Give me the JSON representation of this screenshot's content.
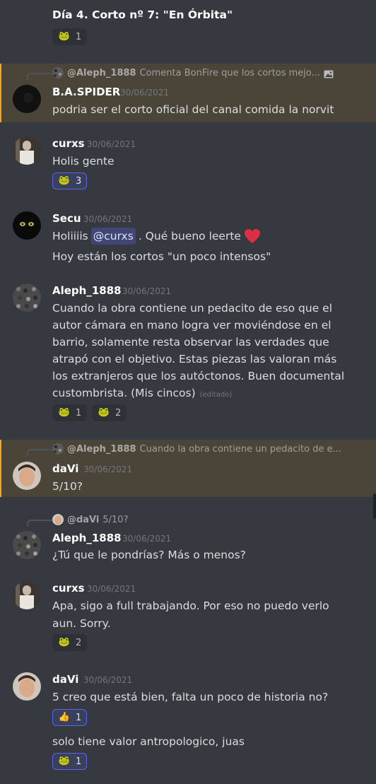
{
  "colors": {
    "background": "#36393f",
    "highlight": "#4a4538",
    "accent": "#faa61a",
    "active_reaction": "#5865f2"
  },
  "top": {
    "title": "Día 4. Corto nº 7: \"En Órbita\"",
    "reaction": {
      "emoji_icon": "pepe-cowboy-icon",
      "emoji": "🐸",
      "count": "1"
    }
  },
  "messages": [
    {
      "reply_user": "@Aleph_1888",
      "reply_text": "Comenta BonFire que los cortos mejo...",
      "reply_attachment_icon": "image-icon",
      "username": "B.A.SPIDER",
      "timestamp": "30/06/2021",
      "lines": [
        "podria ser el corto oficial del canal comida la norvit"
      ]
    },
    {
      "username": "curxs",
      "timestamp": "30/06/2021",
      "lines": [
        "Holis gente"
      ],
      "reactions": [
        {
          "emoji_icon": "pepe-hype-icon",
          "emoji": "🐸",
          "count": "3"
        }
      ]
    },
    {
      "username": "Secu",
      "timestamp": "30/06/2021",
      "line1_before": "Holiiiis",
      "mention": "@curxs",
      "line1_after": ". Qué bueno leerte",
      "heart_icon": "red-heart-icon",
      "line2": "Hoy están los cortos \"un poco intensos\""
    },
    {
      "username": "Aleph_1888",
      "timestamp": "30/06/2021",
      "lines": [
        "Cuando la obra contiene un pedacito de eso que el",
        "autor cámara en mano logra ver moviéndose en el",
        "barrio, solamente resta observar las verdades que",
        "atrapó con el objetivo. Estas piezas las valoran más",
        "los extranjeros que los autóctonos. Buen documental",
        "custombrista. (Mis cincos)"
      ],
      "edited": "(editado)",
      "reactions": [
        {
          "emoji_icon": "pepe-thinking-icon",
          "emoji": "🐸",
          "count": "1"
        },
        {
          "emoji_icon": "pepe-smug-icon",
          "emoji": "🐸",
          "count": "2"
        }
      ]
    },
    {
      "reply_user": "@Aleph_1888",
      "reply_text": "Cuando la obra contiene un pedacito de e...",
      "username": "daVi",
      "timestamp": "30/06/2021",
      "lines": [
        "5/10?"
      ]
    },
    {
      "reply_user": "@daVi",
      "reply_text": "5/10?",
      "username": "Aleph_1888",
      "timestamp": "30/06/2021",
      "lines": [
        "¿Tú que le pondrías? Más o menos?"
      ]
    },
    {
      "username": "curxs",
      "timestamp": "30/06/2021",
      "lines": [
        "Apa, sigo a full trabajando. Por eso no puedo verlo",
        "aun. Sorry."
      ],
      "reactions": [
        {
          "emoji_icon": "pepe-sad-icon",
          "emoji": "🐸",
          "count": "2"
        }
      ]
    },
    {
      "username": "daVi",
      "timestamp": "30/06/2021",
      "lines": [
        "5 creo que está bien, falta un poco de historia no?"
      ],
      "reactions": [
        {
          "emoji_icon": "thumbs-up-icon",
          "emoji": "👍",
          "count": "1"
        }
      ],
      "followup": "solo tiene valor antropologico, juas",
      "followup_reactions": [
        {
          "emoji_icon": "pepe-hiding-icon",
          "emoji": "🐸",
          "count": "1"
        }
      ]
    }
  ]
}
